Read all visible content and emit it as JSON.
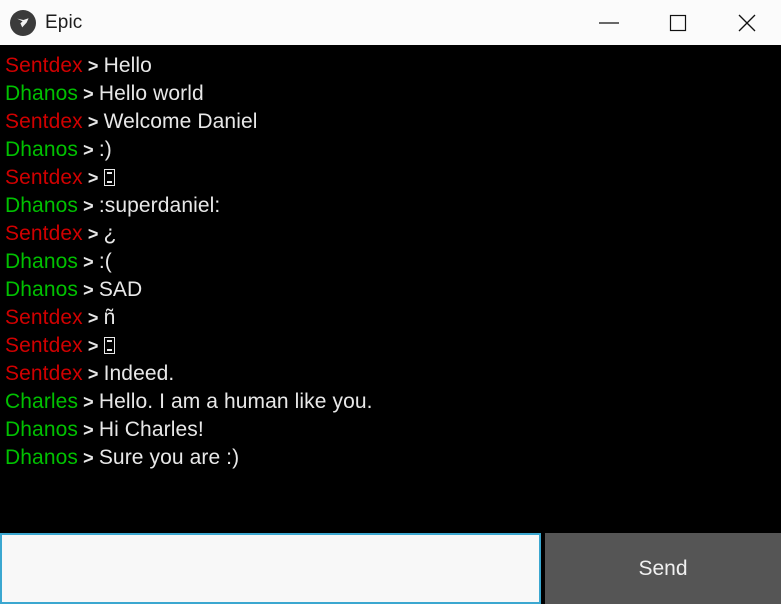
{
  "window": {
    "title": "Epic",
    "icon": "epic-app-icon",
    "background": "#000000",
    "titlebar_background": "#fbfbfb",
    "controls": [
      {
        "name": "minimize",
        "glyph": "minimize-icon"
      },
      {
        "name": "maximize",
        "glyph": "maximize-icon"
      },
      {
        "name": "close",
        "glyph": "close-icon"
      }
    ]
  },
  "colors": {
    "sentdex": "#d00000",
    "dhanos": "#00c000",
    "charles": "#00c000",
    "message": "#e8e8e8",
    "separator": "#e6e6e6",
    "input_border": "#3ba7d0",
    "input_background": "#f8f8f8",
    "send_background": "#555555"
  },
  "chat": {
    "separator": " > ",
    "messages": [
      {
        "speaker": "Sentdex",
        "speaker_class": "speaker-sentdex",
        "text": "Hello"
      },
      {
        "speaker": "Dhanos",
        "speaker_class": "speaker-dhanos",
        "text": "Hello world"
      },
      {
        "speaker": "Sentdex",
        "speaker_class": "speaker-sentdex",
        "text": "Welcome Daniel"
      },
      {
        "speaker": "Dhanos",
        "speaker_class": "speaker-dhanos",
        "text": ":)"
      },
      {
        "speaker": "Sentdex",
        "speaker_class": "speaker-sentdex",
        "text": "▯",
        "tofu": true
      },
      {
        "speaker": "Dhanos",
        "speaker_class": "speaker-dhanos",
        "text": ":superdaniel:"
      },
      {
        "speaker": "Sentdex",
        "speaker_class": "speaker-sentdex",
        "text": "¿"
      },
      {
        "speaker": "Dhanos",
        "speaker_class": "speaker-dhanos",
        "text": ":("
      },
      {
        "speaker": "Dhanos",
        "speaker_class": "speaker-dhanos",
        "text": "SAD"
      },
      {
        "speaker": "Sentdex",
        "speaker_class": "speaker-sentdex",
        "text": "ñ"
      },
      {
        "speaker": "Sentdex",
        "speaker_class": "speaker-sentdex",
        "text": "▯",
        "tofu": true
      },
      {
        "speaker": "Sentdex",
        "speaker_class": "speaker-sentdex",
        "text": "Indeed."
      },
      {
        "speaker": "Charles",
        "speaker_class": "speaker-charles",
        "text": "Hello. I am a human like you."
      },
      {
        "speaker": "Dhanos",
        "speaker_class": "speaker-dhanos",
        "text": "Hi Charles!"
      },
      {
        "speaker": "Dhanos",
        "speaker_class": "speaker-dhanos",
        "text": "Sure you are :)"
      }
    ]
  },
  "composer": {
    "input_value": "",
    "input_placeholder": "",
    "send_label": "Send"
  }
}
